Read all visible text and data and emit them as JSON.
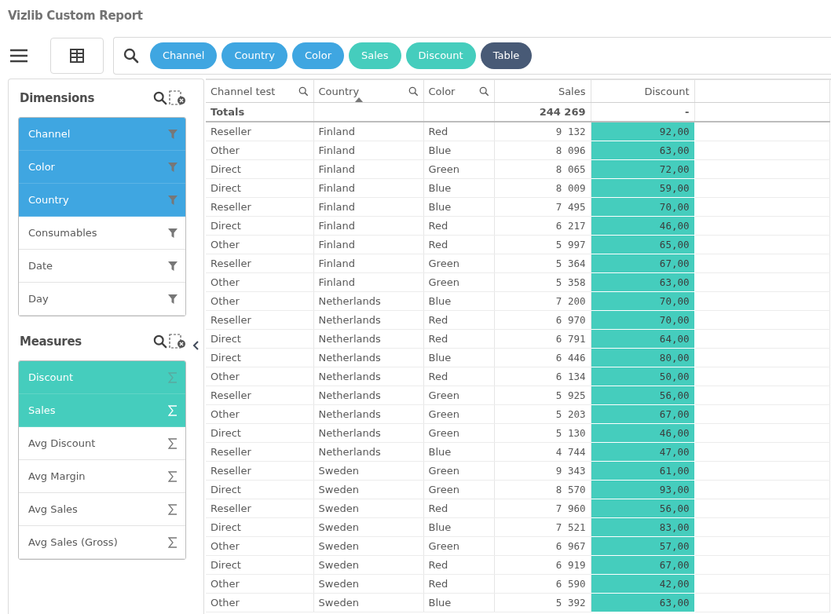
{
  "title": "Vizlib Custom Report",
  "chips": [
    {
      "label": "Channel",
      "kind": "dimension"
    },
    {
      "label": "Country",
      "kind": "dimension"
    },
    {
      "label": "Color",
      "kind": "dimension"
    },
    {
      "label": "Sales",
      "kind": "measure"
    },
    {
      "label": "Discount",
      "kind": "measure"
    },
    {
      "label": "Table",
      "kind": "chart"
    }
  ],
  "dimensions": {
    "title": "Dimensions",
    "items": [
      {
        "label": "Channel",
        "selected": true
      },
      {
        "label": "Color",
        "selected": true
      },
      {
        "label": "Country",
        "selected": true
      },
      {
        "label": "Consumables",
        "selected": false
      },
      {
        "label": "Date",
        "selected": false
      },
      {
        "label": "Day",
        "selected": false
      }
    ]
  },
  "measures": {
    "title": "Measures",
    "items": [
      {
        "label": "Discount",
        "selected": true
      },
      {
        "label": "Sales",
        "selected": true
      },
      {
        "label": "Avg Discount",
        "selected": false
      },
      {
        "label": "Avg Margin",
        "selected": false
      },
      {
        "label": "Avg Sales",
        "selected": false
      },
      {
        "label": "Avg Sales (Gross)",
        "selected": false
      }
    ]
  },
  "table": {
    "columns": [
      {
        "label": "Channel test",
        "kind": "dimension",
        "sorted": false
      },
      {
        "label": "Country",
        "kind": "dimension",
        "sorted": true
      },
      {
        "label": "Color",
        "kind": "dimension",
        "sorted": false
      },
      {
        "label": "Sales",
        "kind": "measure",
        "sorted": false
      },
      {
        "label": "Discount",
        "kind": "highlighted",
        "sorted": false
      }
    ],
    "totals": {
      "label": "Totals",
      "measures": [
        "244 269",
        "-"
      ]
    },
    "rows": [
      [
        "Reseller",
        "Finland",
        "Red",
        "9 132",
        "92,00"
      ],
      [
        "Other",
        "Finland",
        "Blue",
        "8 096",
        "63,00"
      ],
      [
        "Direct",
        "Finland",
        "Green",
        "8 065",
        "72,00"
      ],
      [
        "Direct",
        "Finland",
        "Blue",
        "8 009",
        "59,00"
      ],
      [
        "Reseller",
        "Finland",
        "Blue",
        "7 495",
        "70,00"
      ],
      [
        "Direct",
        "Finland",
        "Red",
        "6 217",
        "46,00"
      ],
      [
        "Other",
        "Finland",
        "Red",
        "5 997",
        "65,00"
      ],
      [
        "Reseller",
        "Finland",
        "Green",
        "5 364",
        "67,00"
      ],
      [
        "Other",
        "Finland",
        "Green",
        "5 358",
        "63,00"
      ],
      [
        "Other",
        "Netherlands",
        "Blue",
        "7 200",
        "70,00"
      ],
      [
        "Reseller",
        "Netherlands",
        "Red",
        "6 970",
        "70,00"
      ],
      [
        "Direct",
        "Netherlands",
        "Red",
        "6 791",
        "64,00"
      ],
      [
        "Direct",
        "Netherlands",
        "Blue",
        "6 446",
        "80,00"
      ],
      [
        "Other",
        "Netherlands",
        "Red",
        "6 134",
        "50,00"
      ],
      [
        "Reseller",
        "Netherlands",
        "Green",
        "5 925",
        "56,00"
      ],
      [
        "Other",
        "Netherlands",
        "Green",
        "5 203",
        "67,00"
      ],
      [
        "Direct",
        "Netherlands",
        "Green",
        "5 130",
        "46,00"
      ],
      [
        "Reseller",
        "Netherlands",
        "Blue",
        "4 744",
        "47,00"
      ],
      [
        "Reseller",
        "Sweden",
        "Green",
        "9 343",
        "61,00"
      ],
      [
        "Direct",
        "Sweden",
        "Green",
        "8 570",
        "93,00"
      ],
      [
        "Reseller",
        "Sweden",
        "Red",
        "7 960",
        "56,00"
      ],
      [
        "Direct",
        "Sweden",
        "Blue",
        "7 521",
        "83,00"
      ],
      [
        "Other",
        "Sweden",
        "Green",
        "6 967",
        "57,00"
      ],
      [
        "Direct",
        "Sweden",
        "Red",
        "6 919",
        "67,00"
      ],
      [
        "Other",
        "Sweden",
        "Red",
        "6 590",
        "42,00"
      ],
      [
        "Other",
        "Sweden",
        "Blue",
        "5 392",
        "63,00"
      ]
    ]
  }
}
